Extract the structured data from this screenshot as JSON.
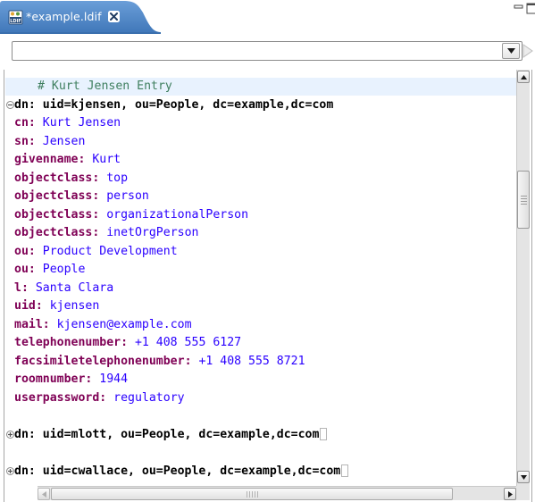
{
  "tab": {
    "title": "*example.ldif",
    "icon": "ldif-file-icon",
    "icon_text": "LDIF",
    "active_color": "#4a84c7"
  },
  "navigation": {
    "value": "",
    "placeholder": ""
  },
  "editor": {
    "lines": [
      {
        "kind": "comment",
        "text": "# Kurt Jensen Entry",
        "current": true
      },
      {
        "kind": "dn",
        "fold": "expanded",
        "text": "dn: uid=kjensen, ou=People, dc=example,dc=com"
      },
      {
        "kind": "attr",
        "name": "cn",
        "value": "Kurt Jensen"
      },
      {
        "kind": "attr",
        "name": "sn",
        "value": "Jensen"
      },
      {
        "kind": "attr",
        "name": "givenname",
        "value": "Kurt"
      },
      {
        "kind": "attr",
        "name": "objectclass",
        "value": "top"
      },
      {
        "kind": "attr",
        "name": "objectclass",
        "value": "person"
      },
      {
        "kind": "attr",
        "name": "objectclass",
        "value": "organizationalPerson"
      },
      {
        "kind": "attr",
        "name": "objectclass",
        "value": "inetOrgPerson"
      },
      {
        "kind": "attr",
        "name": "ou",
        "value": "Product Development"
      },
      {
        "kind": "attr",
        "name": "ou",
        "value": "People"
      },
      {
        "kind": "attr",
        "name": "l",
        "value": "Santa Clara"
      },
      {
        "kind": "attr",
        "name": "uid",
        "value": "kjensen"
      },
      {
        "kind": "attr",
        "name": "mail",
        "value": "kjensen@example.com"
      },
      {
        "kind": "attr",
        "name": "telephonenumber",
        "value": "+1 408 555 6127"
      },
      {
        "kind": "attr",
        "name": "facsimiletelephonenumber",
        "value": "+1 408 555 8721"
      },
      {
        "kind": "attr",
        "name": "roomnumber",
        "value": "1944"
      },
      {
        "kind": "attr",
        "name": "userpassword",
        "value": "regulatory"
      },
      {
        "kind": "blank"
      },
      {
        "kind": "dn",
        "fold": "collapsed",
        "text": "dn: uid=mlott, ou=People, dc=example,dc=com"
      },
      {
        "kind": "blank"
      },
      {
        "kind": "dn",
        "fold": "collapsed",
        "text": "dn: uid=cwallace, ou=People, dc=example,dc=com"
      }
    ]
  },
  "colors": {
    "attribute": "#7f0055",
    "value": "#2a00ff",
    "comment": "#3f7f5f",
    "current_line": "#e8f2fe"
  }
}
